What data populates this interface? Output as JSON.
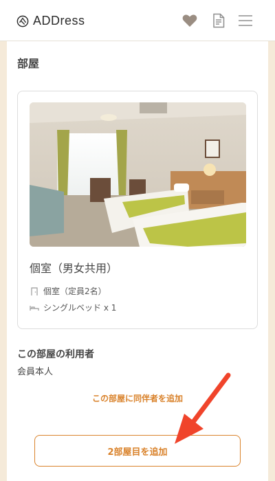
{
  "header": {
    "brand": "ADDress",
    "icons": [
      "addr-logo-icon",
      "heart-icon",
      "document-icon",
      "hamburger-menu-icon"
    ]
  },
  "room_section": {
    "title": "部屋",
    "card": {
      "room_name": "個室（男女共用）",
      "details": [
        {
          "icon": "door-icon",
          "text": "個室（定員2名）"
        },
        {
          "icon": "bed-icon",
          "text": "シングルベッド x 1"
        }
      ]
    }
  },
  "users": {
    "heading": "この部屋の利用者",
    "value": "会員本人"
  },
  "actions": {
    "add_companion": "この部屋に同伴者を追加",
    "add_room": "2部屋目を追加"
  },
  "colors": {
    "accent": "#d9822b",
    "background": "#f5ead9",
    "annotation_arrow": "#f0442b"
  }
}
